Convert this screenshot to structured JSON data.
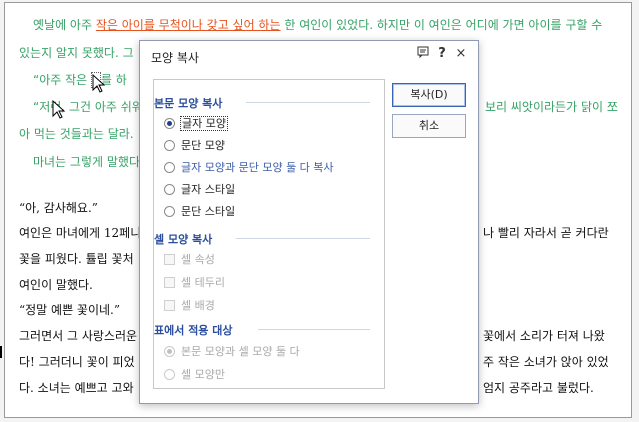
{
  "document": {
    "p1_a": "옛날에 아주 ",
    "p1_hl": "작은 아이를 무척이나 갖고 싶어 하는",
    "p1_b": " 한 여인이 있었다. 하지만 이 여인은 어디에 가면 아이를 구할 수",
    "p2": "있는지 알지 못했다. 그",
    "p3": "“아주 작은 ",
    "p3b": "를 하",
    "p4_left": "“저런, 그건 아주 쉬워",
    "p4_right": "보리 씨앗이라든가 닭이 쪼",
    "p5": "아 먹는 것들과는 달라.",
    "p6": "마녀는 그렇게 말했다",
    "p7": "“아, 감사해요.”",
    "p8_left": "여인은 마녀에게 12페니",
    "p8_right": "나 빨리 자라서 곧 커다란",
    "p9": "꽃을 피웠다. 튤립 꽃처",
    "p10": "여인이 말했다.",
    "p11": "“정말 예쁜 꽃이네.”",
    "p12_left": "그러면서 그 사랑스러운",
    "p12_right": "꽃에서 소리가 터져 나왔",
    "p13_left": "다! 그러더니 꽃이 피었",
    "p13_right": "주 작은 소녀가 앉아 있었",
    "p14_left": "다. 소녀는 예쁘고 고와",
    "p14_right": "엄지 공주라고 불렀다."
  },
  "dialog": {
    "title": "모양 복사",
    "icons": [
      "message-icon",
      "help-icon",
      "close-icon"
    ],
    "help_glyph": "?",
    "close_glyph": "×",
    "section1": "본문 모양 복사",
    "options1": [
      "글자 모양",
      "문단 모양",
      "글자 모양과 문단 모양 둘 다 복사",
      "글자 스타일",
      "문단 스타일"
    ],
    "selected1": "글자 모양",
    "section2": "셀 모양 복사",
    "options2": [
      "셀 속성",
      "셀 테두리",
      "셀 배경"
    ],
    "section3": "표에서 적용 대상",
    "options3": [
      "본문 모양과 셀 모양 둘 다",
      "셀 모양만"
    ],
    "copy_button": "복사(D)",
    "cancel_button": "취소"
  },
  "colors": {
    "green_text": "#36a266",
    "highlight": "#e8531d",
    "section_blue": "#2b4f9e"
  }
}
